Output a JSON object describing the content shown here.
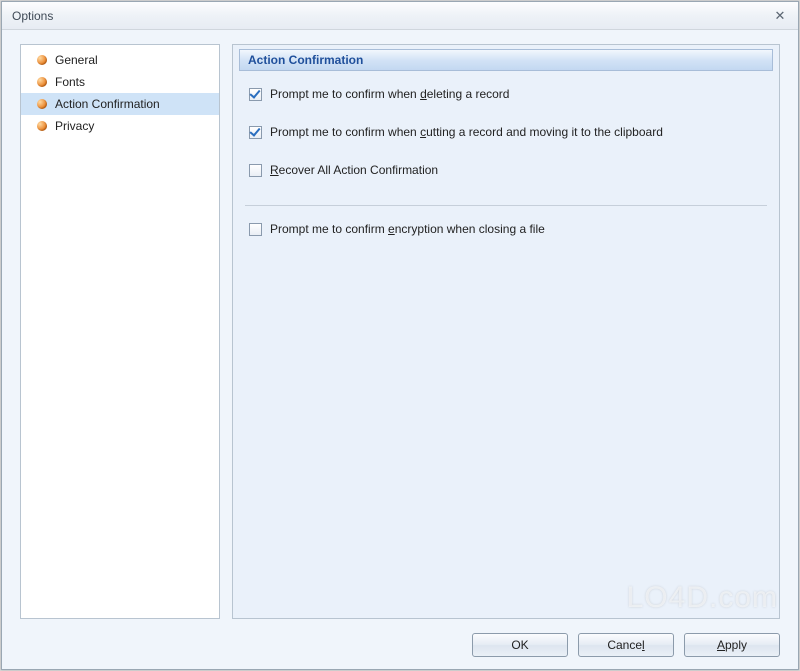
{
  "window": {
    "title": "Options",
    "close_glyph": "✕"
  },
  "sidebar": {
    "items": [
      {
        "label": "General",
        "selected": false
      },
      {
        "label": "Fonts",
        "selected": false
      },
      {
        "label": "Action Confirmation",
        "selected": true
      },
      {
        "label": "Privacy",
        "selected": false
      }
    ]
  },
  "panel": {
    "header": "Action Confirmation",
    "checks": [
      {
        "checked": true,
        "pre": "Prompt me to confirm when ",
        "u": "d",
        "post": "eleting a record"
      },
      {
        "checked": true,
        "pre": "Prompt me to confirm when ",
        "u": "c",
        "post": "utting a record and moving it to the clipboard"
      },
      {
        "checked": false,
        "pre": "",
        "u": "R",
        "post": "ecover All Action Confirmation"
      }
    ],
    "checks2": [
      {
        "checked": false,
        "pre": "Prompt me to confirm ",
        "u": "e",
        "post": "ncryption when closing a file"
      }
    ]
  },
  "buttons": {
    "ok": {
      "pre": "OK",
      "u": "",
      "post": ""
    },
    "cancel": {
      "pre": "Cance",
      "u": "l",
      "post": ""
    },
    "apply": {
      "pre": "",
      "u": "A",
      "post": "pply"
    }
  },
  "watermark": "LO4D.com"
}
